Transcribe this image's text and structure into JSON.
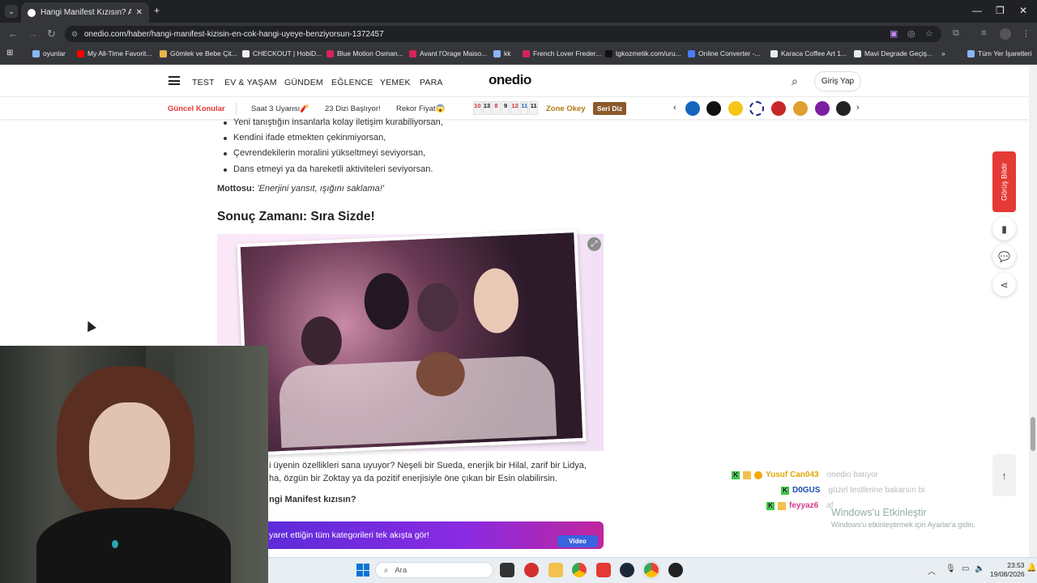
{
  "browser": {
    "tab_title": "Hangi Manifest Kızısın? Aura R...",
    "url": "onedio.com/haber/hangi-manifest-kizisin-en-cok-hangi-uyeye-benziyorsun-1372457",
    "bookmarks": [
      "oyunlar",
      "My All-Time Favorit...",
      "Gömlek ve Bebe Çit...",
      "CHECKOUT | HobiD...",
      "Blue Motion Osman...",
      "Avant l'Orage Maiso...",
      "kk",
      "French Lover Freder...",
      "tgkozmetik.com/uru...",
      "Online Converter -...",
      "Karaca Coffee Art 1...",
      "Mavi Degrade Geçiş...",
      "Tüm Yer İşaretleri"
    ],
    "bookmark_colors": [
      "#8ab4f8",
      "#ff0000",
      "#e9b44c",
      "#eeeeee",
      "#d6245b",
      "#d6245b",
      "#8ab4f8",
      "#d6245b",
      "#111111",
      "#4a7cff",
      "#e8eaed",
      "#e8eaed",
      "#8ab4f8"
    ]
  },
  "site": {
    "logo": "onedio",
    "nav": [
      "TEST",
      "EV & YAŞAM",
      "GÜNDEM",
      "EĞLENCE",
      "YEMEK",
      "PARA"
    ],
    "login": "Giriş Yap",
    "topics_label": "Güncel Konular",
    "topics": [
      "Saat 3 Uyarısı🧨",
      "23 Dizi Başlıyor!",
      "Rekor Fiyat😱"
    ],
    "zone_numbers": [
      "10",
      "13",
      "8",
      "9",
      "12",
      "11",
      "11"
    ],
    "zone_okey": "Zone Okey",
    "seri_diz": "Seri Diz"
  },
  "article": {
    "list": [
      "Yeni tanıştığın insanlarla kolay iletişim kurabiliyorsan,",
      "Kendini ifade etmekten çekinmiyorsan,",
      "Çevrendekilerin moralini yükseltmeyi seviyorsan,",
      "Dans etmeyi ya da hareketli aktiviteleri seviyorsan."
    ],
    "motto_label": "Mottosu:",
    "motto": "'Enerjini yansıt, ışığını saklama!'",
    "heading": "Sonuç Zamanı: Sıra Sizde!",
    "para1": "i üyenin özellikleri sana uyuyor? Neşeli bir Sueda, enerjik bir Hilal, zarif bir Lidya,",
    "para2": "ha, özgün bir Zoktay ya da pozitif enerjisiyle öne çıkan bir Esin olabilirsin.",
    "question": "ngi Manifest kızısın?",
    "banner": "yaret ettiğin tüm kategorileri tek akışta gör!",
    "video_btn": "Video"
  },
  "side": {
    "feedback": "Görüş Bildir"
  },
  "chat": [
    {
      "user": "Yusuf Can043",
      "msg": "onedio batıyor",
      "color": "#e2a400"
    },
    {
      "user": "D0GUS",
      "msg": "güzel testlerine bakarsın bi",
      "color": "#1a4db0"
    },
    {
      "user": "feyyaz6",
      "msg": "af",
      "color": "#d23c8c"
    }
  ],
  "windows": {
    "activate_title": "Windows'u Etkinleştir",
    "activate_sub": "Windows'u etkinleştirmek için Ayarlar'a gidin.",
    "search": "Ara",
    "time": "23:53",
    "date": "19/08/2026"
  }
}
